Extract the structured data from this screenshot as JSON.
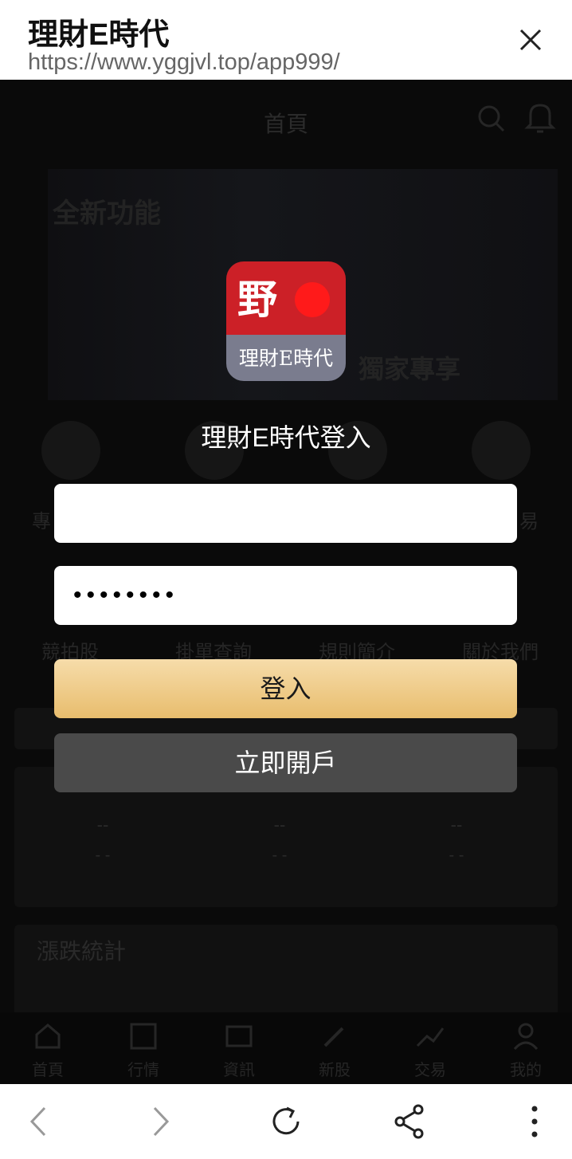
{
  "browser": {
    "title": "理財E時代",
    "url": "https://www.yggjvl.top/app999/"
  },
  "background_page": {
    "header_title": "首頁",
    "banner_left_text": "全新功能",
    "banner_right_text": "獨家專享",
    "row1_labels": [
      "專",
      "易"
    ],
    "row2_labels": [
      "競拍股",
      "掛單查詢",
      "規則簡介",
      "關於我們"
    ],
    "stats": [
      {
        "v1": "--",
        "v2": "- -"
      },
      {
        "v1": "--",
        "v2": "- -"
      },
      {
        "v1": "--",
        "v2": "- -"
      }
    ],
    "rise_fall_title": "漲跌統計",
    "tabs": [
      "首頁",
      "行情",
      "資訊",
      "新股",
      "交易",
      "我的"
    ]
  },
  "modal": {
    "logo_brand": "野",
    "logo_sub": "理財E時代",
    "title": "理財E時代登入",
    "username_value": "",
    "password_value": "••••••••",
    "login_label": "登入",
    "open_account_label": "立即開戶"
  },
  "colors": {
    "accent_gold": "#e8bd6d",
    "logo_red": "#cc2027",
    "open_button": "#4a4a4a"
  }
}
